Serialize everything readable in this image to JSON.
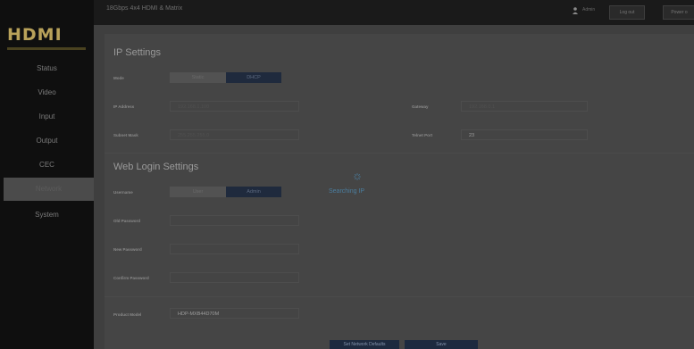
{
  "app": {
    "logo": "HDMI",
    "device_title": "18Gbps 4x4 HDMI & Matrix"
  },
  "topbar": {
    "user": "Admin",
    "logout_label": "Log out",
    "power_label": "Power o"
  },
  "sidebar": {
    "items": [
      {
        "label": "Status"
      },
      {
        "label": "Video"
      },
      {
        "label": "Input"
      },
      {
        "label": "Output"
      },
      {
        "label": "CEC"
      },
      {
        "label": "Network"
      },
      {
        "label": "System"
      }
    ],
    "active": "Network"
  },
  "ip_settings": {
    "title": "IP Settings",
    "mode_label": "Mode",
    "mode_options": [
      "Static",
      "DHCP"
    ],
    "mode_selected": "DHCP",
    "ip_label": "IP Address",
    "ip_value": "192.168.1.100",
    "gateway_label": "Gateway",
    "gateway_value": "192.168.0.1",
    "subnet_label": "Subnet Mask",
    "subnet_value": "255.255.255.0",
    "telnet_label": "Telnet Port",
    "telnet_value": "23"
  },
  "web_login": {
    "title": "Web Login Settings",
    "username_label": "Username",
    "username_options": [
      "User",
      "Admin"
    ],
    "username_selected": "Admin",
    "old_password_label": "Old Password",
    "new_password_label": "New Password",
    "confirm_password_label": "Confirm Password"
  },
  "product": {
    "model_label": "Product Model",
    "model_value": "HDP-MXB44D70M"
  },
  "overlay": {
    "status": "Searching IP"
  },
  "actions": {
    "defaults_label": "Set Network Defaults",
    "save_label": "Save"
  },
  "colors": {
    "accent": "#1f2a3d",
    "overlay_text": "#4a7ea0",
    "logo": "#b9a25a"
  }
}
